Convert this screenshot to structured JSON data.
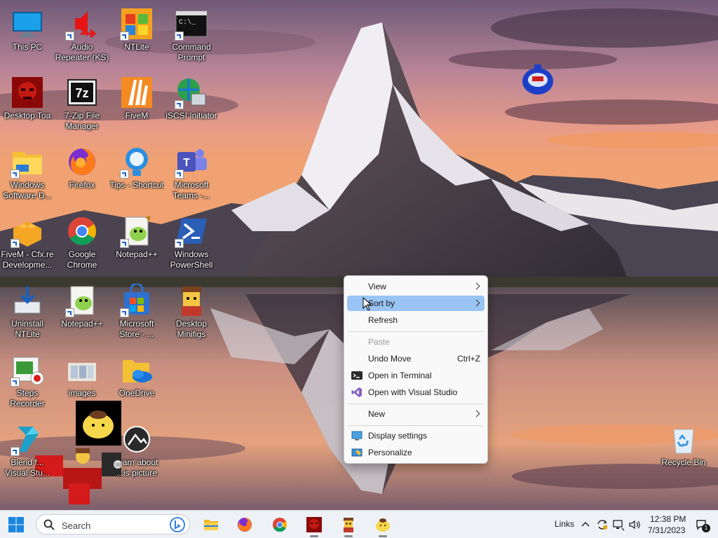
{
  "desktop": {
    "icons": [
      {
        "label": "This PC"
      },
      {
        "label": "Audio Repeater (KS)"
      },
      {
        "label": "NTLite"
      },
      {
        "label": "Command Prompt"
      },
      {
        "label": "Desktop Toa"
      },
      {
        "label": "7-Zip File Manager"
      },
      {
        "label": "FiveM"
      },
      {
        "label": "iSCSI Initiator"
      },
      {
        "label": "Windows Software D..."
      },
      {
        "label": "Firefox"
      },
      {
        "label": "Tips - Shortcut"
      },
      {
        "label": "Microsoft Teams -..."
      },
      {
        "label": "FiveM - Cfx.re Developme..."
      },
      {
        "label": "Google Chrome"
      },
      {
        "label": "Notepad++"
      },
      {
        "label": "Windows PowerShell"
      },
      {
        "label": "Uninstall NTLite"
      },
      {
        "label": "Notepad++"
      },
      {
        "label": "Microsoft Store - ..."
      },
      {
        "label": "Desktop Minifigs"
      },
      {
        "label": "Steps Recorder"
      },
      {
        "label": "images"
      },
      {
        "label": "OneDrive"
      },
      {
        "label": "Blend f... Visual Stu..."
      },
      {
        "label": "...arn about ...is picture"
      },
      {
        "label": "Recycle Bin"
      }
    ],
    "icon_glyphs": {
      "prompt": "C:\\_",
      "sevenzip": "7z"
    }
  },
  "context_menu": {
    "items": [
      {
        "label": "View"
      },
      {
        "label": "Sort by"
      },
      {
        "label": "Refresh"
      },
      {
        "label": "Paste"
      },
      {
        "label": "Undo Move",
        "shortcut": "Ctrl+Z"
      },
      {
        "label": "Open in Terminal"
      },
      {
        "label": "Open with Visual Studio"
      },
      {
        "label": "New"
      },
      {
        "label": "Display settings"
      },
      {
        "label": "Personalize"
      }
    ]
  },
  "taskbar": {
    "search_placeholder": "Search",
    "links_label": "Links",
    "time": "12:38 PM",
    "date": "7/31/2023",
    "notification_count": "1",
    "pinned": [
      "start-icon",
      "file-explorer-icon",
      "firefox-icon",
      "chrome-icon",
      "desktop-toa-icon",
      "minifig-icon",
      "pompompurin-icon"
    ]
  },
  "colors": {
    "menu_hover": "#99c4f3",
    "taskbar_bg": "#eef1f6",
    "accent_blue": "#0078d4"
  }
}
